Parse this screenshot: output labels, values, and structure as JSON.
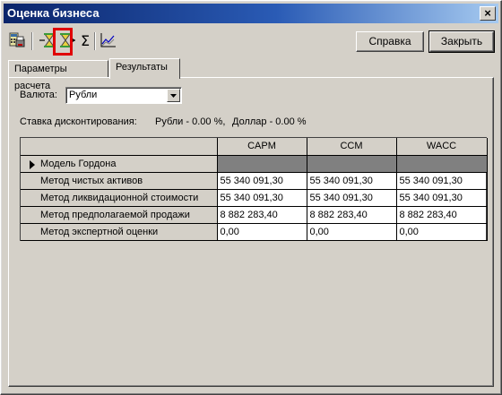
{
  "window": {
    "title": "Оценка бизнеса",
    "close_glyph": "×"
  },
  "toolbar": {
    "buttons": [
      {
        "icon": "calculator-print-icon"
      },
      {
        "icon": "hourglass-left-icon"
      },
      {
        "icon": "hourglass-right-icon"
      },
      {
        "icon": "sum-icon",
        "glyph": "Σ"
      },
      {
        "icon": "chart-icon"
      }
    ],
    "help_label": "Справка",
    "close_label": "Закрыть"
  },
  "tabs": [
    {
      "label": "Параметры расчета",
      "active": false
    },
    {
      "label": "Результаты",
      "active": true
    }
  ],
  "currency": {
    "label": "Валюта:",
    "value": "Рубли"
  },
  "discount": {
    "label": "Ставка дисконтирования:",
    "rub": "Рубли -  0.00 %,",
    "usd": "Доллар -  0.00 %"
  },
  "grid": {
    "columns": [
      "CAPM",
      "CCM",
      "WACC"
    ],
    "rows": [
      {
        "label": "Модель Гордона",
        "values": [
          "",
          "",
          ""
        ],
        "current": true
      },
      {
        "label": "Метод чистых активов",
        "values": [
          "55 340 091,30",
          "55 340 091,30",
          "55 340 091,30"
        ]
      },
      {
        "label": "Метод ликвидационной стоимости",
        "values": [
          "55 340 091,30",
          "55 340 091,30",
          "55 340 091,30"
        ]
      },
      {
        "label": "Метод предполагаемой продажи",
        "values": [
          "8 882 283,40",
          "8 882 283,40",
          "8 882 283,40"
        ]
      },
      {
        "label": "Метод экспертной оценки",
        "values": [
          "0,00",
          "0,00",
          "0,00"
        ]
      }
    ]
  },
  "colors": {
    "title_start": "#0a246a",
    "title_end": "#a6caf0",
    "highlight": "#e00000"
  }
}
